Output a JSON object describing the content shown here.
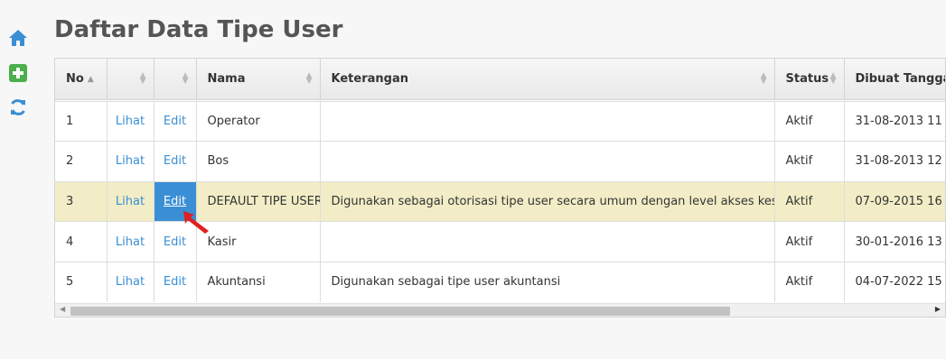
{
  "sidebar": {
    "icons": [
      {
        "name": "home-icon",
        "color": "#3a8fd4"
      },
      {
        "name": "add-icon",
        "color": "#4cae4c"
      },
      {
        "name": "refresh-icon",
        "color": "#3a8fd4"
      }
    ]
  },
  "page": {
    "title": "Daftar Data Tipe User"
  },
  "table": {
    "headers": {
      "no": "No",
      "nama": "Nama",
      "keterangan": "Keterangan",
      "status": "Status",
      "dibuat": "Dibuat Tangga"
    },
    "rows": [
      {
        "no": "1",
        "lihat": "Lihat",
        "edit": "Edit",
        "nama": "Operator",
        "keterangan": "",
        "status": "Aktif",
        "dibuat": "31-08-2013 11"
      },
      {
        "no": "2",
        "lihat": "Lihat",
        "edit": "Edit",
        "nama": "Bos",
        "keterangan": "",
        "status": "Aktif",
        "dibuat": "31-08-2013 12"
      },
      {
        "no": "3",
        "lihat": "Lihat",
        "edit": "Edit",
        "nama": "DEFAULT TIPE USER",
        "keterangan": "Digunakan sebagai otorisasi tipe user secara umum dengan level akses keseluruhan",
        "status": "Aktif",
        "dibuat": "07-09-2015 16"
      },
      {
        "no": "4",
        "lihat": "Lihat",
        "edit": "Edit",
        "nama": "Kasir",
        "keterangan": "",
        "status": "Aktif",
        "dibuat": "30-01-2016 13"
      },
      {
        "no": "5",
        "lihat": "Lihat",
        "edit": "Edit",
        "nama": "Akuntansi",
        "keterangan": "Digunakan sebagai tipe user akuntansi",
        "status": "Aktif",
        "dibuat": "04-07-2022 15"
      }
    ]
  },
  "colors": {
    "highlight_row": "#f2edc6",
    "link": "#3a8fd4",
    "pointer_arrow": "#e02020"
  }
}
